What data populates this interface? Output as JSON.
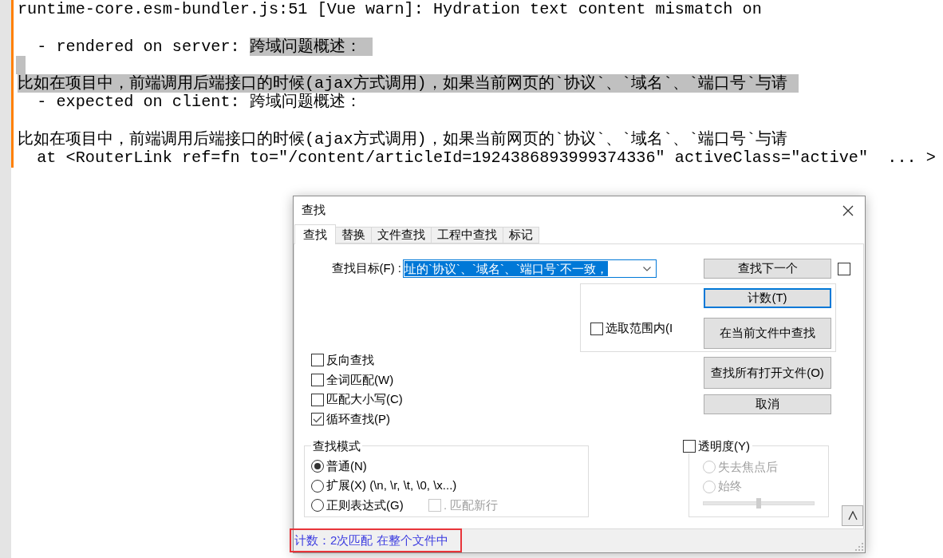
{
  "editor": {
    "lines": [
      {
        "kind": "text",
        "modified": true,
        "spans": [
          {
            "text": "runtime-core.esm-bundler.js:51 [Vue warn]: Hydration text content mismatch on",
            "selected": false
          }
        ]
      },
      {
        "kind": "blank",
        "modified": true,
        "selected": false
      },
      {
        "kind": "text",
        "modified": true,
        "spans": [
          {
            "text": "  - rendered on server: ",
            "selected": false
          },
          {
            "text": "跨域问题概述：",
            "selected": true
          }
        ]
      },
      {
        "kind": "blank",
        "modified": true,
        "selected": true
      },
      {
        "kind": "text",
        "modified": true,
        "spans": [
          {
            "text": "比如在项目中，前端调用后端接口的时候(ajax方式调用)，如果当前网页的`协议`、`域名`、`端口号`与请",
            "selected": true
          }
        ]
      },
      {
        "kind": "text",
        "modified": true,
        "spans": [
          {
            "text": "  - expected on client: 跨域问题概述：",
            "selected": false
          }
        ]
      },
      {
        "kind": "blank",
        "modified": true,
        "selected": false
      },
      {
        "kind": "text",
        "modified": true,
        "spans": [
          {
            "text": "比如在项目中，前端调用后端接口的时候(ajax方式调用)，如果当前网页的`协议`、`域名`、`端口号`与请",
            "selected": false
          }
        ]
      },
      {
        "kind": "text",
        "modified": true,
        "spans": [
          {
            "text": "  at <RouterLink ref=fn to=\"/content/articleId=1924386893999374336\" activeClass=\"active\"  ... >",
            "selected": false
          }
        ]
      }
    ]
  },
  "find_dialog": {
    "title": "查找",
    "tabs": [
      {
        "label": "查找",
        "selected": true
      },
      {
        "label": "替换",
        "selected": false
      },
      {
        "label": "文件查找",
        "selected": false
      },
      {
        "label": "工程中查找",
        "selected": false
      },
      {
        "label": "标记",
        "selected": false
      }
    ],
    "find_what": {
      "label": "查找目标(F) :",
      "value": "址的`协议`、`域名`、`端口号`不一致，",
      "selected": true,
      "focused": true
    },
    "find_next": {
      "label": "查找下一个",
      "focused": false
    },
    "side_checkbox": {
      "checked": false
    },
    "selection_group": {
      "checkbox": {
        "label": "选取范围内(I",
        "checked": false
      },
      "buttons": [
        {
          "label": "计数(T)",
          "focused": true
        },
        {
          "label": "在当前文件中查找",
          "focused": false
        }
      ]
    },
    "options": [
      {
        "label": "反向查找",
        "checked": false
      },
      {
        "label": "全词匹配(W)",
        "checked": false
      },
      {
        "label": "匹配大小写(C)",
        "checked": false
      },
      {
        "label": "循环查找(P)",
        "checked": true
      }
    ],
    "actions": [
      {
        "label": "查找所有打开文件(O)",
        "focused": false
      },
      {
        "label": "取消",
        "focused": false
      }
    ],
    "search_mode": {
      "title": "查找模式",
      "options": [
        {
          "label": "普通(N)",
          "selected": true
        },
        {
          "label": "扩展(X) (\\n, \\r, \\t, \\0, \\x...)",
          "selected": false
        },
        {
          "label": "正则表达式(G)",
          "selected": false
        }
      ],
      "dot_newline": {
        "label": ". 匹配新行",
        "checked": false,
        "disabled": true
      }
    },
    "transparency": {
      "label": "透明度(Y)",
      "checked": false,
      "disabled": true,
      "options": [
        {
          "label": "失去焦点后",
          "selected": false
        },
        {
          "label": "始终",
          "selected": false
        }
      ],
      "level": 0.5
    },
    "status_bar": {
      "text": "计数：2次匹配 在整个文件中",
      "marked": true
    }
  }
}
